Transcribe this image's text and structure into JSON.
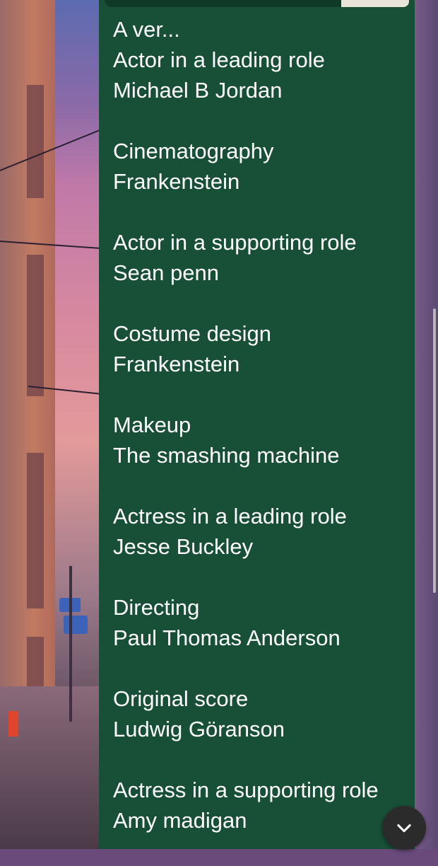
{
  "note": {
    "truncated_line": "A ver...",
    "categories": [
      {
        "category": "Actor in a leading role",
        "winner": "Michael B Jordan"
      },
      {
        "category": "Cinematography",
        "winner": "Frankenstein"
      },
      {
        "category": "Actor in a supporting role",
        "winner": "Sean penn"
      },
      {
        "category": "Costume design",
        "winner": "Frankenstein"
      },
      {
        "category": "Makeup",
        "winner": "The smashing machine"
      },
      {
        "category": "Actress in a leading role",
        "winner": "Jesse Buckley"
      },
      {
        "category": "Directing",
        "winner": "Paul Thomas Anderson"
      },
      {
        "category": "Original score",
        "winner": "Ludwig Göranson"
      },
      {
        "category": "Actress in a supporting role",
        "winner": "Amy madigan"
      }
    ]
  },
  "controls": {
    "scroll_down_icon": "chevron-down-icon"
  },
  "colors": {
    "panel_bg": "#184f37",
    "text": "#ffffff",
    "button_bg": "#2b2b2b"
  }
}
